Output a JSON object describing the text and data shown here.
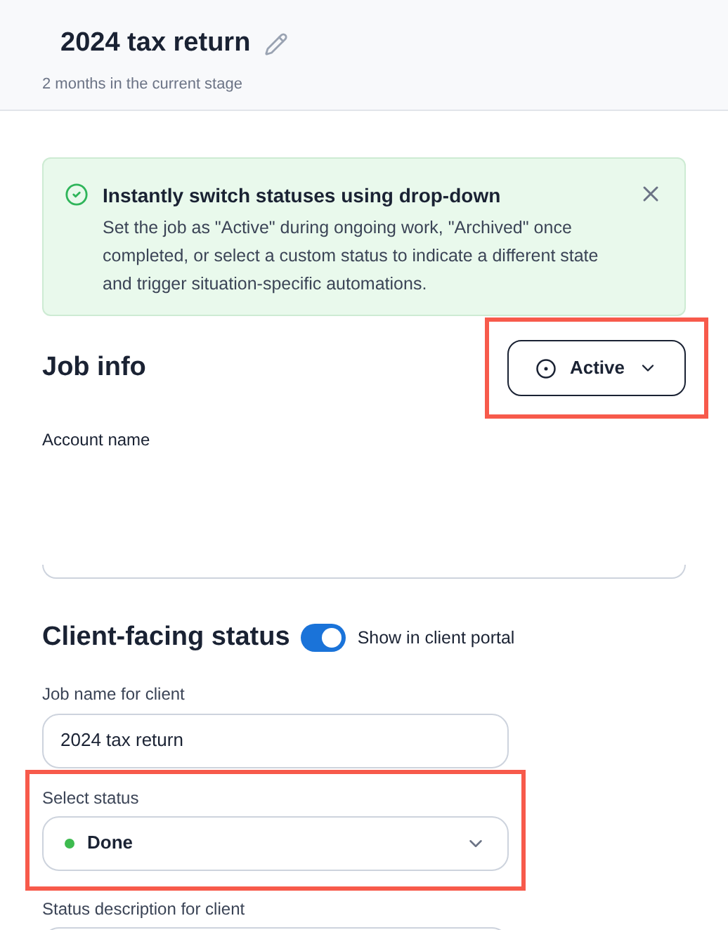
{
  "header": {
    "title": "2024 tax return",
    "subtitle": "2 months in the current stage"
  },
  "banner": {
    "title": "Instantly switch statuses using drop-down",
    "body": "Set the job as \"Active\" during ongoing work, \"Archived\" once completed, or select a custom status to indicate a different state and trigger situation-specific automations."
  },
  "job_info": {
    "heading": "Job info",
    "status_button": "Active",
    "highlighted": true,
    "field_label": "Account name"
  },
  "client_status": {
    "heading": "Client-facing status",
    "toggle": {
      "label": "Show in client portal",
      "on": true
    },
    "job_name_label": "Job name for client",
    "job_name_value": "2024 tax return",
    "select_label": "Select status",
    "select_value": {
      "label": "Done",
      "color": "#3dbb4f"
    },
    "highlighted": true,
    "description_label": "Status description for client"
  }
}
